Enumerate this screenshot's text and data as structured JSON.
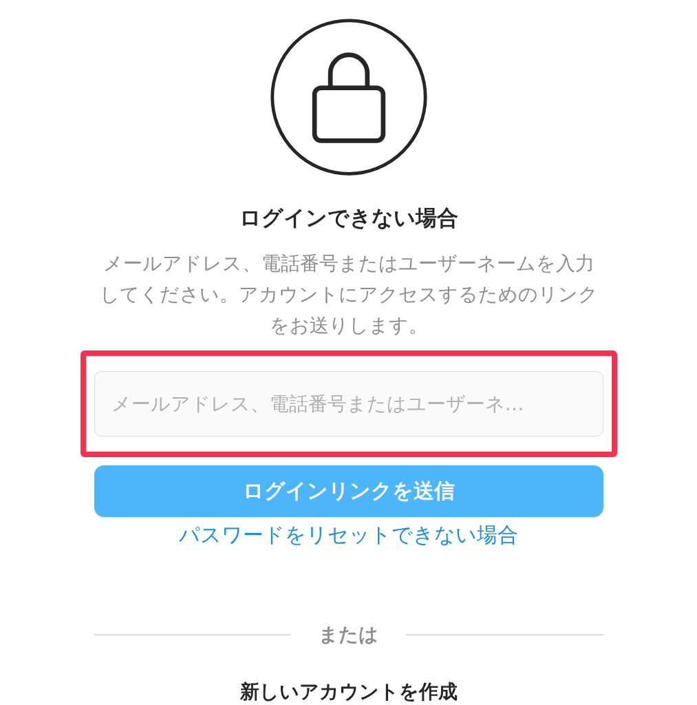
{
  "title": "ログインできない場合",
  "description": "メールアドレス、電話番号またはユーザーネームを入力してください。アカウントにアクセスするためのリンクをお送りします。",
  "input": {
    "placeholder": "メールアドレス、電話番号またはユーザーネ…",
    "highlighted": true
  },
  "submit_button": "ログインリンクを送信",
  "reset_link": "パスワードをリセットできない場合",
  "divider": "または",
  "create_account": "新しいアカウントを作成"
}
